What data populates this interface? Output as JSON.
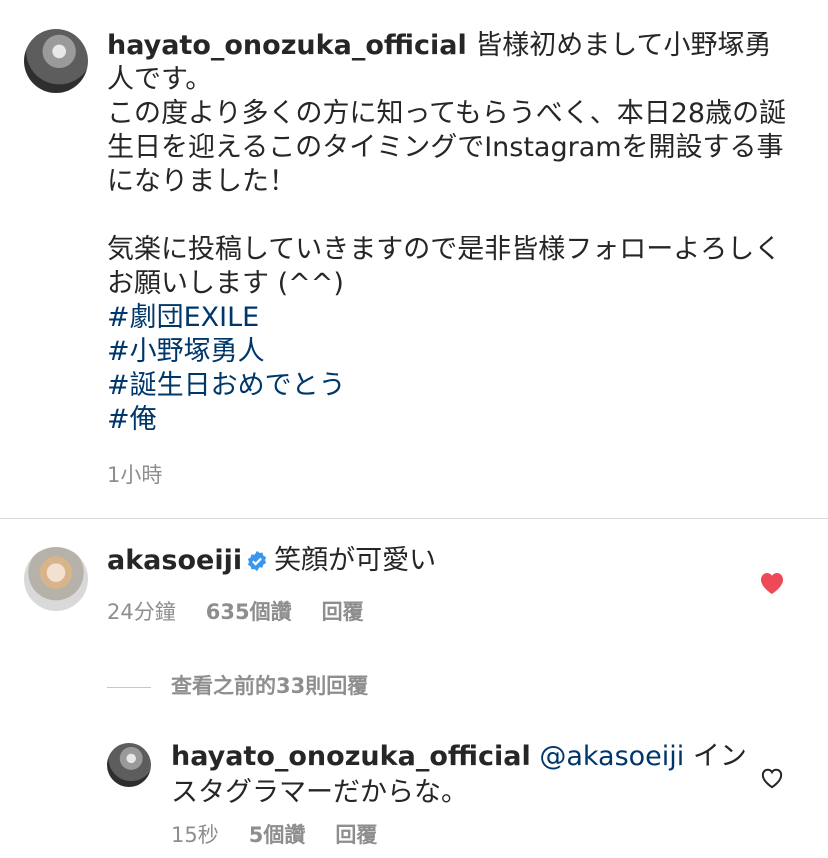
{
  "post": {
    "username": "hayato_onozuka_official",
    "caption_body": " 皆様初めまして小野塚勇人です。\nこの度より多くの方に知ってもらうべく、本日28歳の誕生日を迎えるこのタイミングでInstagramを開設する事になりました！\n\n気楽に投稿していきますので是非皆様フォローよろしくお願いします (^^)",
    "hashtags": [
      "#劇団EXILE",
      "#小野塚勇人",
      "#誕生日おめでとう",
      "#俺"
    ],
    "time": "1小時"
  },
  "comment": {
    "username": "akasoeiji",
    "text": "笑顔が可愛い",
    "time": "24分鐘",
    "likes": "635個讚",
    "reply_label": "回覆",
    "liked": true,
    "heart_color": "#ed4956"
  },
  "view_previous": "查看之前的33則回覆",
  "reply": {
    "username": "hayato_onozuka_official",
    "mention": "@akasoeiji",
    "text": " インスタグラマーだからな。",
    "time": "15秒",
    "likes": "5個讚",
    "reply_label": "回覆",
    "liked": false
  },
  "colors": {
    "link": "#00376b",
    "secondary": "#8e8e8e",
    "verified": "#3897f0"
  }
}
